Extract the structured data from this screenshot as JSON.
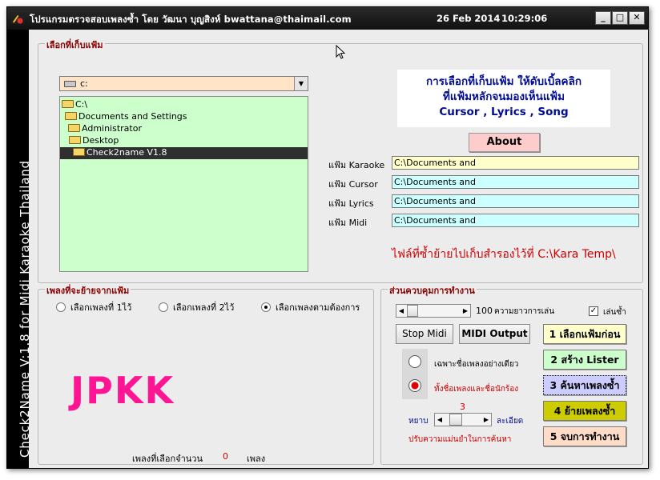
{
  "window": {
    "title": "โปรแกรมตรวจสอบเพลงซ้ำ โดย วัฒนา บุญสิงห์ bwattana@thaimail.com",
    "date": "26 Feb 2014",
    "time": "10:29:06",
    "controls": {
      "minimize": "_",
      "maximize": "□",
      "close": "✕"
    }
  },
  "sidebar": {
    "text": "Check2Name  V:1.8   for  Midi  Karaoke  Thailand"
  },
  "folder_section": {
    "legend": "เลือกที่เก็บแฟ้ม",
    "drive": "c:",
    "tree": [
      {
        "label": "C:\\",
        "indent": 0,
        "selected": false
      },
      {
        "label": "Documents and Settings",
        "indent": 1,
        "selected": false
      },
      {
        "label": "Administrator",
        "indent": 2,
        "selected": false
      },
      {
        "label": "Desktop",
        "indent": 3,
        "selected": false
      },
      {
        "label": "Check2name V1.8",
        "indent": 4,
        "selected": true
      }
    ]
  },
  "info": {
    "line1": "การเลือกที่เก็บแฟ้ม ให้ดับเบิ้ลคลิก",
    "line2": "ที่แฟ้มหลักจนมองเห็นแฟ้ม",
    "line3": "Cursor , Lyrics , Song"
  },
  "about_button": "About",
  "paths": [
    {
      "label": "แฟ้ม Karaoke",
      "value": "C:\\Documents and",
      "color": "#ffffcc"
    },
    {
      "label": "แฟ้ม Cursor",
      "value": "C:\\Documents and",
      "color": "#ccffff"
    },
    {
      "label": "แฟ้ม Lyrics",
      "value": "C:\\Documents and",
      "color": "#ccffff"
    },
    {
      "label": "แฟ้ม Midi",
      "value": "C:\\Documents and",
      "color": "#ccffff"
    }
  ],
  "notice": "ไฟล์ที่ซ้ำย้ายไปเก็บสำรองไว้ที่ C:\\Kara Temp\\",
  "song_section": {
    "legend": "เพลงที่จะย้ายจากแฟ้ม",
    "options": [
      {
        "label": "เลือกเพลงที่ 1ไว้",
        "checked": false
      },
      {
        "label": "เลือกเพลงที่ 2ไว้",
        "checked": false
      },
      {
        "label": "เลือกเพลงตามต้องการ",
        "checked": true
      }
    ],
    "logo_text": "JPKK",
    "count_label": "เพลงที่เลือกจำนวน",
    "count_value": "0",
    "count_unit": "เพลง"
  },
  "control_section": {
    "legend": "ส่วนควบคุมการทำงาน",
    "play_length_value": "100",
    "play_length_label": "ความยาวการเล่น",
    "repeat_label": "เล่นซ้ำ",
    "repeat_checked": true,
    "stop_midi": "Stop Midi",
    "midi_output": "MIDI Output",
    "match_options": [
      {
        "label": "เฉพาะชื่อเพลงอย่างเดียว",
        "checked": false
      },
      {
        "label": "ทั้งชื่อเพลงและชื่อนักร้อง",
        "checked": true
      }
    ],
    "precision_value": "3",
    "coarse_label": "หยาบ",
    "fine_label": "ละเอียด",
    "precision_caption": "ปรับความแม่นยำในการค้นหา",
    "steps": [
      {
        "label": "1 เลือกแฟ้มก่อน",
        "color": "#ffffcc"
      },
      {
        "label": "2 สร้าง Lister",
        "color": "#ccffcc"
      },
      {
        "label": "3 ค้นหาเพลงซ้ำ",
        "color": "#ccccff"
      },
      {
        "label": "4 ย้ายเพลงซ้ำ",
        "color": "#cccc00"
      },
      {
        "label": "5 จบการทำงาน",
        "color": "#ffdcc8"
      }
    ]
  }
}
